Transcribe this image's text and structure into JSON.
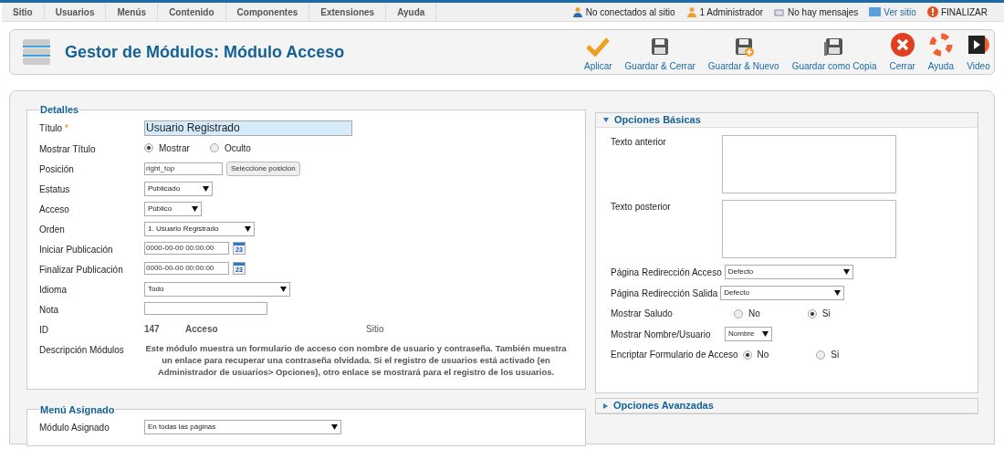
{
  "top_menu": [
    {
      "label": "Sitio"
    },
    {
      "label": "Usuarios"
    },
    {
      "label": "Menús"
    },
    {
      "label": "Contenido"
    },
    {
      "label": "Componentes"
    },
    {
      "label": "Extensiones"
    },
    {
      "label": "Ayuda"
    }
  ],
  "status_links": [
    {
      "kind": "users",
      "label": "No conectados al sitio"
    },
    {
      "kind": "admin",
      "label": "1 Administrador"
    },
    {
      "kind": "messages",
      "label": "No hay mensajes"
    },
    {
      "kind": "site",
      "label": "Ver sitio"
    },
    {
      "kind": "logout",
      "label": "FINALIZAR"
    }
  ],
  "page_title": "Gestor de Módulos: Módulo Acceso",
  "toolbar": [
    {
      "kind": "apply",
      "label": "Aplicar"
    },
    {
      "kind": "save",
      "label": "Guardar & Cerrar"
    },
    {
      "kind": "save_new",
      "label": "Guardar & Nuevo"
    },
    {
      "kind": "save_copy",
      "label": "Guardar como Copia"
    },
    {
      "kind": "close",
      "label": "Cerrar"
    },
    {
      "kind": "help",
      "label": "Ayuda"
    },
    {
      "kind": "video",
      "label": "Video"
    }
  ],
  "details": {
    "legend": "Detalles",
    "fields": [
      {
        "kind": "text",
        "label": "Título",
        "required_mark": "*",
        "value": "Usuario Registrado"
      },
      {
        "kind": "radio",
        "label": "Mostrar Título",
        "options": [
          {
            "label": "Mostrar",
            "selected": true
          },
          {
            "label": "Oculto",
            "selected": false
          }
        ]
      },
      {
        "kind": "position",
        "label": "Posición",
        "value": "right_top",
        "button": "Seleccione posicion"
      },
      {
        "kind": "select",
        "label": "Estatus",
        "value": "Publicado"
      },
      {
        "kind": "select",
        "label": "Acceso",
        "value": "Público"
      },
      {
        "kind": "select",
        "label": "Orden",
        "value": "1. Usuario Registrado"
      },
      {
        "kind": "date",
        "label": "Iniciar Publicación",
        "value": "0000-00-00 00:00:00",
        "icon_text": "23"
      },
      {
        "kind": "date",
        "label": "Finalizar Publicación",
        "value": "0000-00-00 00:00:00",
        "icon_text": "23"
      },
      {
        "kind": "select",
        "label": "Idioma",
        "value": "Todo"
      },
      {
        "kind": "note",
        "label": "Nota"
      },
      {
        "kind": "info",
        "label": "ID",
        "values": [
          "147",
          "Acceso",
          "Sitio"
        ]
      },
      {
        "kind": "description",
        "label": "Descripción Módulos",
        "text": "Este módulo muestra un formulario de acceso con nombre de usuario y contraseña. También muestra un enlace para recuperar una contraseña olvidada. Si el registro de usuarios está activado (en Administrador de usuarios> Opciones), otro enlace se mostrará para el registro de los usuarios."
      }
    ]
  },
  "menu_assignment": {
    "legend": "Menú Asignado",
    "fields": [
      {
        "kind": "select",
        "label": "Módulo Asignado",
        "value": "En todas las páginas"
      }
    ]
  },
  "basic_options": {
    "title": "Opciones Básicas",
    "expanded": true,
    "fields": [
      {
        "kind": "textarea",
        "label": "Texto anterior"
      },
      {
        "kind": "textarea",
        "label": "Texto posterior"
      },
      {
        "kind": "select",
        "label": "Página Redirección Acceso",
        "value": "Defecto"
      },
      {
        "kind": "select",
        "label": "Página Redirección Salida",
        "value": "Defecto"
      },
      {
        "kind": "radio",
        "label": "Mostrar Saludo",
        "options": [
          {
            "label": "No",
            "selected": false
          },
          {
            "label": "Si",
            "selected": true
          }
        ]
      },
      {
        "kind": "select",
        "label": "Mostrar Nombre/Usuario",
        "value": "Nombre"
      },
      {
        "kind": "radio",
        "label": "Encriptar Formulario de Acceso",
        "options": [
          {
            "label": "No",
            "selected": true
          },
          {
            "label": "Si",
            "selected": false
          }
        ]
      }
    ]
  },
  "advanced_options": {
    "title": "Opciones Avanzadas",
    "expanded": false
  }
}
